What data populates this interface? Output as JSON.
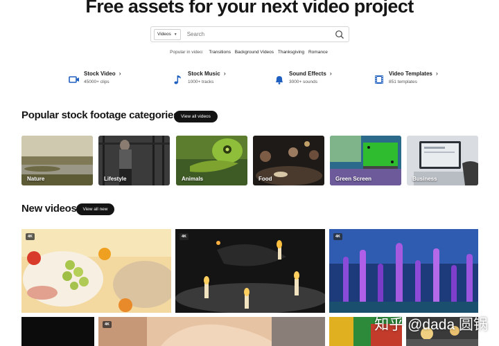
{
  "hero": {
    "title": "Free assets for your next video project"
  },
  "search": {
    "type_label": "Videos",
    "placeholder": "Search"
  },
  "popular": {
    "label": "Popular in video:",
    "terms": [
      "Transitions",
      "Background Videos",
      "Thanksgiving",
      "Romance"
    ]
  },
  "assets": [
    {
      "title": "Stock Video",
      "sub": "45000+ clips",
      "icon": "video-camera-icon"
    },
    {
      "title": "Stock Music",
      "sub": "1000+ tracks",
      "icon": "music-note-icon"
    },
    {
      "title": "Sound Effects",
      "sub": "3000+ sounds",
      "icon": "bell-icon"
    },
    {
      "title": "Video Templates",
      "sub": "851 templates",
      "icon": "film-strip-icon"
    }
  ],
  "categories_section": {
    "title": "Popular stock footage categories",
    "button": "View all videos"
  },
  "categories": [
    "Nature",
    "Lifestyle",
    "Animals",
    "Food",
    "Green Screen",
    "Business"
  ],
  "new_section": {
    "title": "New videos",
    "button": "View all new"
  },
  "videos": [
    {
      "badge": "4K"
    },
    {
      "badge": "4K"
    },
    {
      "badge": "4K"
    },
    {
      "badge": ""
    },
    {
      "badge": "4K"
    },
    {
      "badge": ""
    },
    {
      "badge": ""
    }
  ],
  "watermark": "知乎 @dada 圆锅"
}
